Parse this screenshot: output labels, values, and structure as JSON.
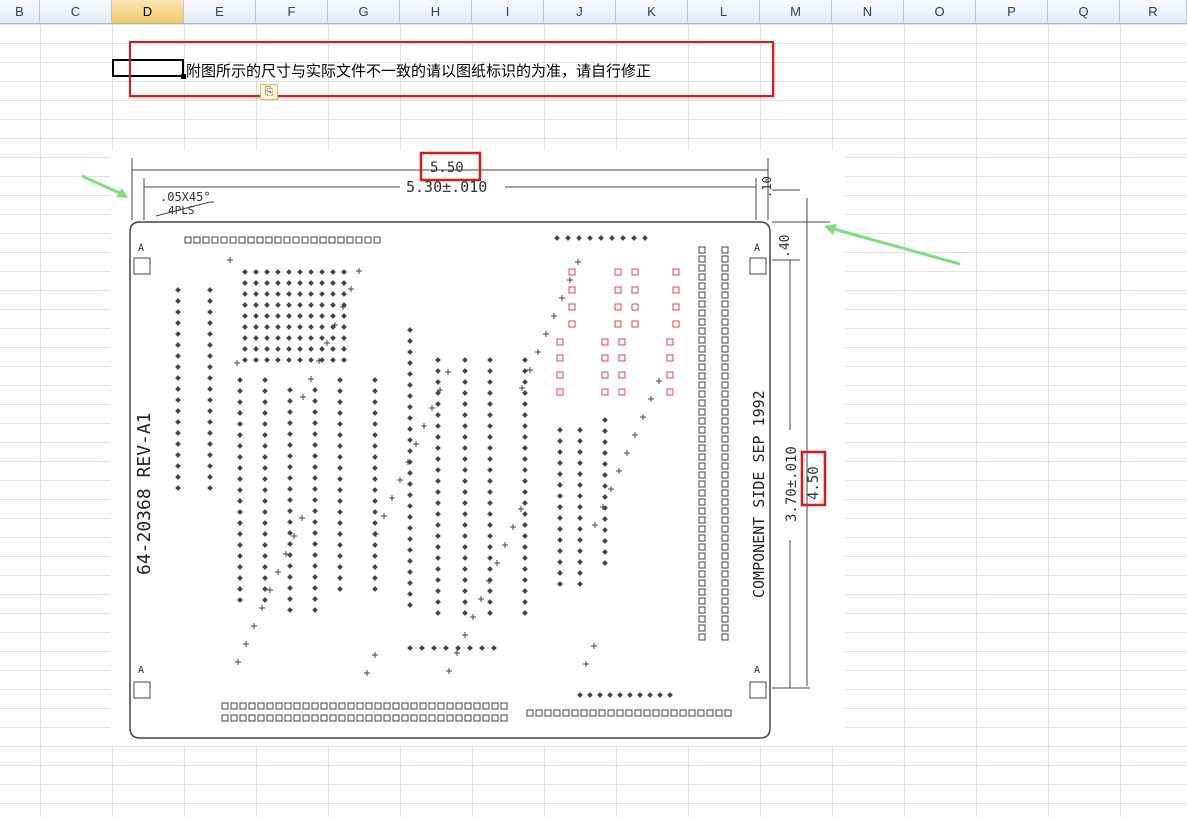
{
  "columns": [
    {
      "label": "B",
      "selected": false
    },
    {
      "label": "C",
      "selected": false
    },
    {
      "label": "D",
      "selected": true
    },
    {
      "label": "E",
      "selected": false
    },
    {
      "label": "F",
      "selected": false
    },
    {
      "label": "G",
      "selected": false
    },
    {
      "label": "H",
      "selected": false
    },
    {
      "label": "I",
      "selected": false
    },
    {
      "label": "J",
      "selected": false
    },
    {
      "label": "K",
      "selected": false
    },
    {
      "label": "L",
      "selected": false
    },
    {
      "label": "M",
      "selected": false
    },
    {
      "label": "N",
      "selected": false
    },
    {
      "label": "O",
      "selected": false
    },
    {
      "label": "P",
      "selected": false
    },
    {
      "label": "Q",
      "selected": false
    },
    {
      "label": "R",
      "selected": false
    }
  ],
  "note": "附图所示的尺寸与实际文件不一致的请以图纸标识的为准，请自行修正",
  "paste_icon": "clipboard-icon",
  "drawing": {
    "dim_top_highlight": "5.50",
    "dim_top_inner": "5.30±.010",
    "dim_chamfer": ".05X45°",
    "dim_chamfer_sub": "4PLS",
    "dim_right_small": ".10",
    "dim_right_offset": ".40",
    "dim_right_inner": "3.70±.010",
    "dim_right_highlight": "4.50",
    "part_number": "64-20368   REV-A1",
    "side_label": "COMPONENT SIDE   SEP 1992",
    "fiducial_label": "A"
  },
  "colors": {
    "highlight": "#e01818",
    "arrow": "#7be27b",
    "pad": "#444444",
    "pad_red": "#d84b4b"
  }
}
